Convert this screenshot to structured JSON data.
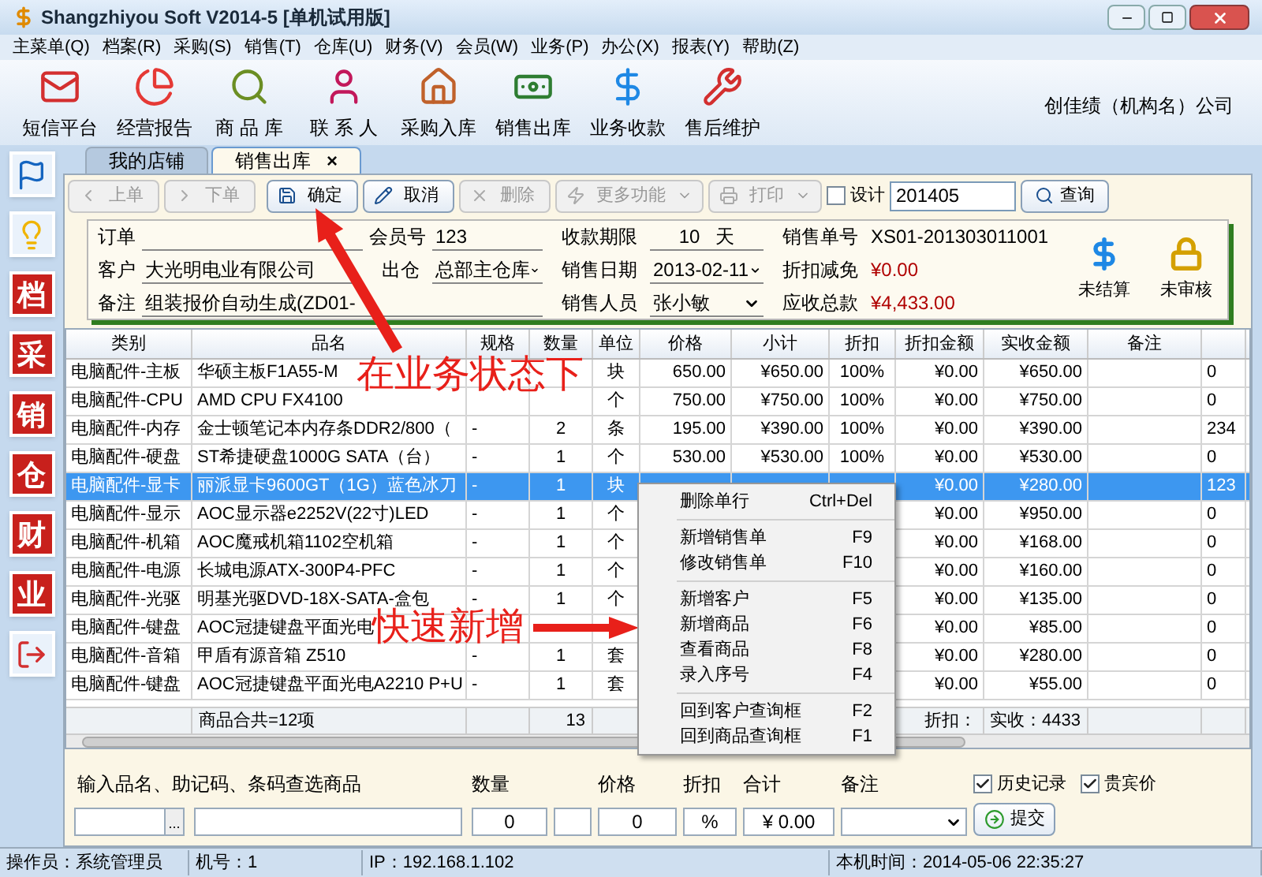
{
  "window": {
    "title": "Shangzhiyou Soft V2014-5 [单机试用版]"
  },
  "menu": [
    "主菜单(Q)",
    "档案(R)",
    "采购(S)",
    "销售(T)",
    "仓库(U)",
    "财务(V)",
    "会员(W)",
    "业务(P)",
    "办公(X)",
    "报表(Y)",
    "帮助(Z)"
  ],
  "toolbar": [
    {
      "label": "短信平台",
      "kind": "mail"
    },
    {
      "label": "经营报告",
      "kind": "chart"
    },
    {
      "label": "商 品 库",
      "kind": "search"
    },
    {
      "label": "联 系 人",
      "kind": "person"
    },
    {
      "label": "采购入库",
      "kind": "house"
    },
    {
      "label": "销售出库",
      "kind": "money"
    },
    {
      "label": "业务收款",
      "kind": "dollar"
    },
    {
      "label": "售后维护",
      "kind": "tools"
    }
  ],
  "company": "创佳绩（机构名）公司",
  "sidebar": [
    {
      "kind": "flag"
    },
    {
      "kind": "bulb"
    },
    {
      "kind": "char",
      "label": "档"
    },
    {
      "kind": "char",
      "label": "采"
    },
    {
      "kind": "char",
      "label": "销"
    },
    {
      "kind": "char",
      "label": "仓"
    },
    {
      "kind": "char",
      "label": "财"
    },
    {
      "kind": "char",
      "label": "业"
    },
    {
      "kind": "door"
    }
  ],
  "tabs": [
    {
      "label": "我的店铺",
      "selected": false
    },
    {
      "label": "销售出库",
      "selected": true,
      "close": "×"
    }
  ],
  "actions": [
    {
      "label": "上单",
      "kind": "prev",
      "disabled": true
    },
    {
      "label": "下单",
      "kind": "next",
      "disabled": true
    },
    {
      "label": "确定",
      "kind": "save",
      "disabled": false
    },
    {
      "label": "取消",
      "kind": "cancel",
      "disabled": false
    },
    {
      "label": "删除",
      "kind": "delete",
      "disabled": true
    },
    {
      "label": "更多功能",
      "kind": "more",
      "disabled": true,
      "dropdown": true
    },
    {
      "label": "打印",
      "kind": "print",
      "disabled": true,
      "dropdown": true
    }
  ],
  "design": {
    "label": "设计",
    "checked": false
  },
  "query": {
    "value": "201405",
    "button": "查询"
  },
  "form": {
    "order": {
      "label": "订单"
    },
    "member": {
      "label": "会员号",
      "value": "123"
    },
    "customer": {
      "label": "客户",
      "value": "大光明电业有限公司"
    },
    "warehouse": {
      "label": "出仓",
      "value": "总部主仓库"
    },
    "remark": {
      "label": "备注",
      "value": "组装报价自动生成(ZD01-"
    },
    "term": {
      "label": "收款期限",
      "value": "10",
      "unit": "天"
    },
    "date": {
      "label": "销售日期",
      "value": "2013-02-11"
    },
    "seller": {
      "label": "销售人员",
      "value": "张小敏"
    },
    "number": {
      "label": "销售单号",
      "value": "XS01-201303011001"
    },
    "discount": {
      "label": "折扣减免",
      "value": "¥0.00"
    },
    "total": {
      "label": "应收总款",
      "value": "¥4,433.00"
    }
  },
  "status": [
    {
      "label": "未结算",
      "kind": "dollar"
    },
    {
      "label": "未审核",
      "kind": "lock"
    }
  ],
  "table": {
    "columns": [
      "类别",
      "品名",
      "规格",
      "数量",
      "单位",
      "价格",
      "小计",
      "折扣",
      "折扣金额",
      "实收金额",
      "备注"
    ],
    "rows": [
      {
        "selected": false,
        "cells": [
          "电脑配件-主板",
          "华硕主板F1A55-M",
          null,
          null,
          "块",
          "650.00",
          "¥650.00",
          "100%",
          "¥0.00",
          "¥650.00",
          null,
          "0"
        ]
      },
      {
        "selected": false,
        "cells": [
          "电脑配件-CPU",
          "AMD CPU FX4100",
          null,
          null,
          "个",
          "750.00",
          "¥750.00",
          "100%",
          "¥0.00",
          "¥750.00",
          null,
          "0"
        ]
      },
      {
        "selected": false,
        "cells": [
          "电脑配件-内存",
          "金士顿笔记本内存条DDR2/800（",
          "-",
          "2",
          "条",
          "195.00",
          "¥390.00",
          "100%",
          "¥0.00",
          "¥390.00",
          null,
          "234"
        ]
      },
      {
        "selected": false,
        "cells": [
          "电脑配件-硬盘",
          "ST希捷硬盘1000G SATA（台）",
          "-",
          "1",
          "个",
          "530.00",
          "¥530.00",
          "100%",
          "¥0.00",
          "¥530.00",
          null,
          "0"
        ]
      },
      {
        "selected": true,
        "cells": [
          "电脑配件-显卡",
          "丽派显卡9600GT（1G）蓝色冰刀",
          "-",
          "1",
          "块",
          null,
          null,
          null,
          "¥0.00",
          "¥280.00",
          null,
          "123"
        ]
      },
      {
        "selected": false,
        "cells": [
          "电脑配件-显示",
          "AOC显示器e2252V(22寸)LED",
          "-",
          "1",
          "个",
          null,
          null,
          null,
          "¥0.00",
          "¥950.00",
          null,
          "0"
        ]
      },
      {
        "selected": false,
        "cells": [
          "电脑配件-机箱",
          "AOC魔戒机箱1102空机箱",
          "-",
          "1",
          "个",
          null,
          null,
          null,
          "¥0.00",
          "¥168.00",
          null,
          "0"
        ]
      },
      {
        "selected": false,
        "cells": [
          "电脑配件-电源",
          "长城电源ATX-300P4-PFC",
          "-",
          "1",
          "个",
          null,
          null,
          null,
          "¥0.00",
          "¥160.00",
          null,
          "0"
        ]
      },
      {
        "selected": false,
        "cells": [
          "电脑配件-光驱",
          "明基光驱DVD-18X-SATA-盒包",
          "-",
          "1",
          "个",
          null,
          null,
          null,
          "¥0.00",
          "¥135.00",
          null,
          "0"
        ]
      },
      {
        "selected": false,
        "cells": [
          "电脑配件-键盘",
          "AOC冠捷键盘平面光电",
          null,
          null,
          null,
          null,
          null,
          null,
          "¥0.00",
          "¥85.00",
          null,
          "0"
        ]
      },
      {
        "selected": false,
        "cells": [
          "电脑配件-音箱",
          "甲盾有源音箱 Z510",
          "-",
          "1",
          "套",
          null,
          null,
          null,
          "¥0.00",
          "¥280.00",
          null,
          "0"
        ]
      },
      {
        "selected": false,
        "cells": [
          "电脑配件-键盘",
          "AOC冠捷键盘平面光电A2210 P+U",
          "-",
          "1",
          "套",
          null,
          null,
          null,
          "¥0.00",
          "¥55.00",
          null,
          "0"
        ]
      }
    ],
    "summary": {
      "count": "商品合共=12项",
      "quantity": "13",
      "discount": "折扣：",
      "received": "实收：4433"
    }
  },
  "context_menu": [
    [
      {
        "label": "删除单行",
        "key": "Ctrl+Del"
      }
    ],
    [
      {
        "label": "新增销售单",
        "key": "F9"
      },
      {
        "label": "修改销售单",
        "key": "F10"
      }
    ],
    [
      {
        "label": "新增客户",
        "key": "F5"
      },
      {
        "label": "新增商品",
        "key": "F6"
      },
      {
        "label": "查看商品",
        "key": "F8"
      },
      {
        "label": "录入序号",
        "key": "F4"
      }
    ],
    [
      {
        "label": "回到客户查询框",
        "key": "F2"
      },
      {
        "label": "回到商品查询框",
        "key": "F1"
      }
    ]
  ],
  "entry": {
    "search_label": "输入品名、助记码、条码查选商品",
    "browse": "...",
    "qty_label": "数量",
    "qty": "0",
    "price_label": "价格",
    "price": "0",
    "discount_label": "折扣",
    "discount": "%",
    "total_label": "合计",
    "total": "¥ 0.00",
    "remark_label": "备注",
    "history": {
      "label": "历史记录",
      "checked": true
    },
    "vip": {
      "label": "贵宾价",
      "checked": true
    },
    "submit": "提交"
  },
  "status_bar": [
    "操作员：系统管理员",
    "机号：1",
    "IP：192.168.1.102",
    "本机时间：2014-05-06 22:35:27"
  ],
  "annotations": [
    "在业务状态下",
    "快速新增"
  ]
}
